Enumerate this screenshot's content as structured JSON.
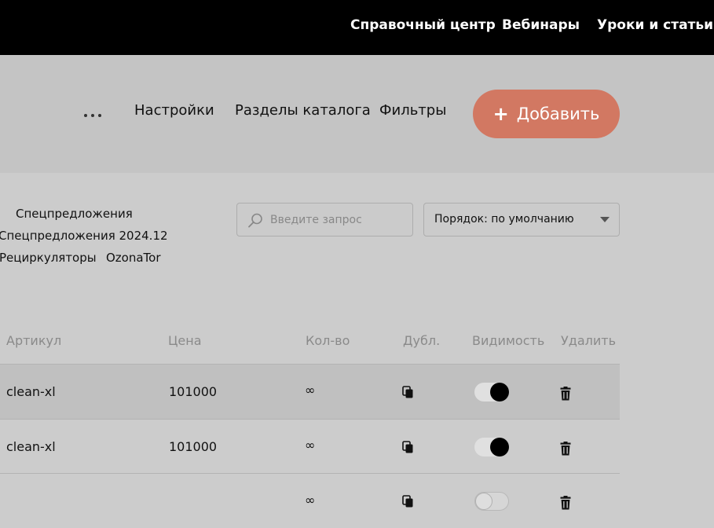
{
  "topnav": {
    "links": [
      "Справочный центр",
      "Вебинары",
      "Уроки и статьи"
    ]
  },
  "toolbar": {
    "links": [
      "Настройки",
      "Разделы каталога",
      "Фильтры"
    ],
    "add_label": "Добавить",
    "accent_color": "#d27862"
  },
  "categories": [
    "Спецпредложения",
    "Спецпредложения 2024.12",
    "Рециркуляторы",
    "OzonaTor"
  ],
  "search": {
    "placeholder": "Введите запрос",
    "value": ""
  },
  "sort": {
    "selected": "Порядок: по умолчанию"
  },
  "table": {
    "headers": {
      "sku": "Артикул",
      "price": "Цена",
      "qty": "Кол-во",
      "dup": "Дубл.",
      "visibility": "Видимость",
      "delete": "Удалить"
    },
    "rows": [
      {
        "sku": "clean-xl",
        "price": "101000",
        "qty": "∞",
        "visible": true
      },
      {
        "sku": "clean-xl",
        "price": "101000",
        "qty": "∞",
        "visible": true
      },
      {
        "sku": "",
        "price": "",
        "qty": "∞",
        "visible": false
      }
    ]
  }
}
